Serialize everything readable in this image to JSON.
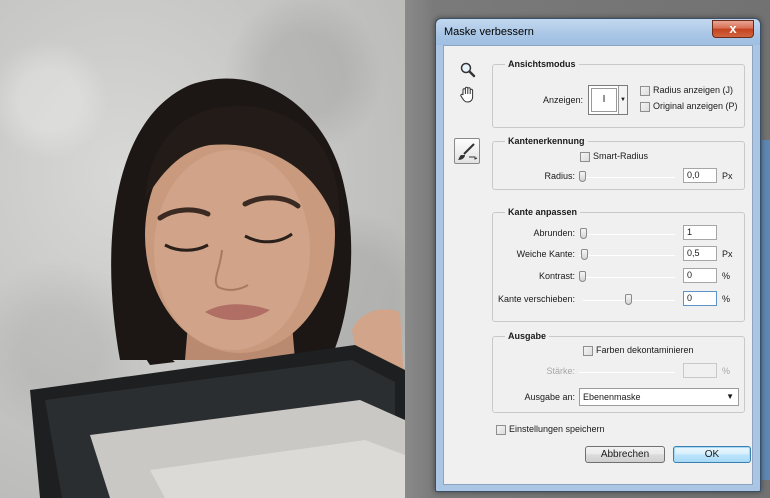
{
  "dialog": {
    "title": "Maske verbessern",
    "close_glyph": "x",
    "tools": {
      "zoom_icon": "magnifier-icon",
      "hand_icon": "hand-icon",
      "brush_icon": "refine-radius-brush-icon"
    }
  },
  "view_mode": {
    "title": "Ansichtsmodus",
    "view_label": "Anzeigen:",
    "view_value": "I",
    "show_radius_label": "Radius anzeigen (J)",
    "show_original_label": "Original anzeigen (P)"
  },
  "edge_detection": {
    "title": "Kantenerkennung",
    "smart_radius_label": "Smart-Radius",
    "radius_label": "Radius:",
    "radius_value": "0,0",
    "radius_unit": "Px",
    "radius_slider": 0.0
  },
  "adjust_edge": {
    "title": "Kante anpassen",
    "smooth_label": "Abrunden:",
    "smooth_value": "1",
    "smooth_slider": 0.01,
    "feather_label": "Weiche Kante:",
    "feather_value": "0,5",
    "feather_unit": "Px",
    "feather_slider": 0.02,
    "contrast_label": "Kontrast:",
    "contrast_value": "0",
    "contrast_unit": "%",
    "contrast_slider": 0.0,
    "shift_label": "Kante verschieben:",
    "shift_value": "0",
    "shift_unit": "%",
    "shift_slider": 0.5
  },
  "output": {
    "title": "Ausgabe",
    "decontaminate_label": "Farben dekontaminieren",
    "amount_label": "Stärke:",
    "amount_unit": "%",
    "output_to_label": "Ausgabe an:",
    "output_to_value": "Ebenenmaske"
  },
  "footer": {
    "remember_label": "Einstellungen speichern",
    "cancel_label": "Abbrechen",
    "ok_label": "OK"
  },
  "colors": {
    "titlebar": "#a9c6e6",
    "close": "#c4421f",
    "client": "#f0f0f0"
  }
}
